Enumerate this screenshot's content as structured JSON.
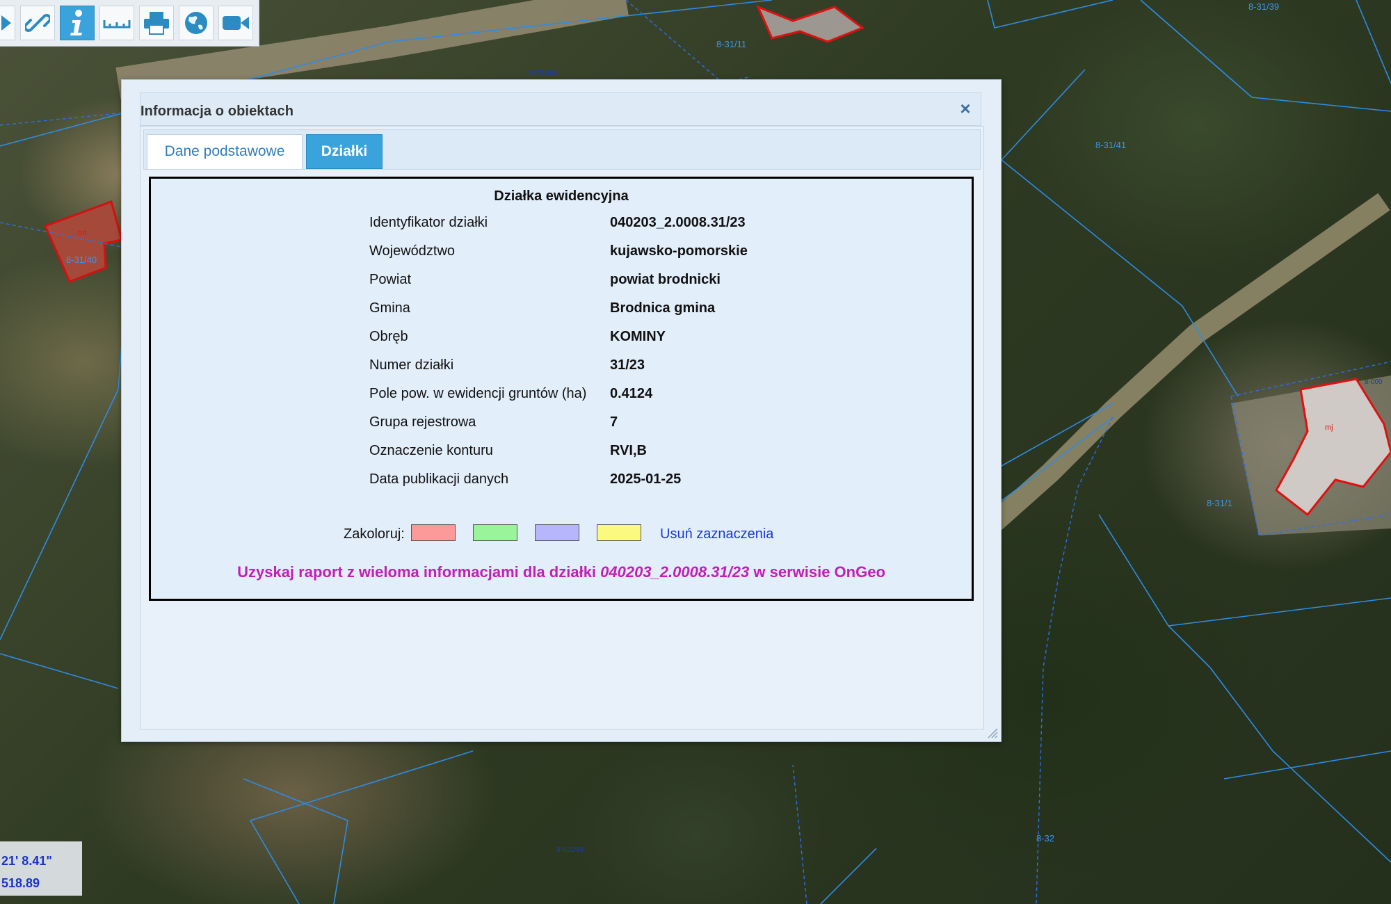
{
  "toolbar": {
    "tools": [
      {
        "icon": "play-icon",
        "active": false
      },
      {
        "icon": "link-icon",
        "active": false
      },
      {
        "icon": "info-icon",
        "active": true
      },
      {
        "icon": "ruler-icon",
        "active": false
      },
      {
        "icon": "print-icon",
        "active": false
      },
      {
        "icon": "globe-icon",
        "active": false
      },
      {
        "icon": "video-camera-icon",
        "active": false
      }
    ]
  },
  "map": {
    "parcel_labels": [
      "8-31/11",
      "8-31/39",
      "8-750/84",
      "8-31/41",
      "8-31/40",
      "8-31/1",
      "8-32",
      "8-621/84"
    ],
    "building_labels": [
      "mt",
      "mj"
    ]
  },
  "coords": {
    "line1": "21' 8.41\"",
    "line2": "518.89"
  },
  "dialog": {
    "title": "Informacja o obiektach",
    "close_symbol": "×",
    "tabs": [
      {
        "label": "Dane podstawowe",
        "active": false
      },
      {
        "label": "Działki",
        "active": true
      }
    ],
    "panel": {
      "heading": "Działka ewidencyjna",
      "rows": [
        {
          "label": "Identyfikator działki",
          "value": "040203_2.0008.31/23"
        },
        {
          "label": "Województwo",
          "value": "kujawsko-pomorskie"
        },
        {
          "label": "Powiat",
          "value": "powiat brodnicki"
        },
        {
          "label": "Gmina",
          "value": "Brodnica gmina"
        },
        {
          "label": "Obręb",
          "value": "KOMINY"
        },
        {
          "label": "Numer działki",
          "value": "31/23"
        },
        {
          "label": "Pole pow. w ewidencji gruntów (ha)",
          "value": "0.4124"
        },
        {
          "label": "Grupa rejestrowa",
          "value": "7"
        },
        {
          "label": "Oznaczenie konturu",
          "value": "RVI,B"
        },
        {
          "label": "Data publikacji danych",
          "value": "2025-01-25"
        }
      ],
      "colorize": {
        "label": "Zakoloruj:",
        "swatches": [
          "#fb9a99",
          "#9af59a",
          "#b7b5fb",
          "#fcf980"
        ],
        "remove_link": "Usuń zaznaczenia"
      },
      "report": {
        "prefix": "Uzyskaj raport z wieloma informacjami dla działki ",
        "parcel_id": "040203_2.0008.31/23",
        "suffix": " w serwisie OnGeo"
      }
    }
  }
}
